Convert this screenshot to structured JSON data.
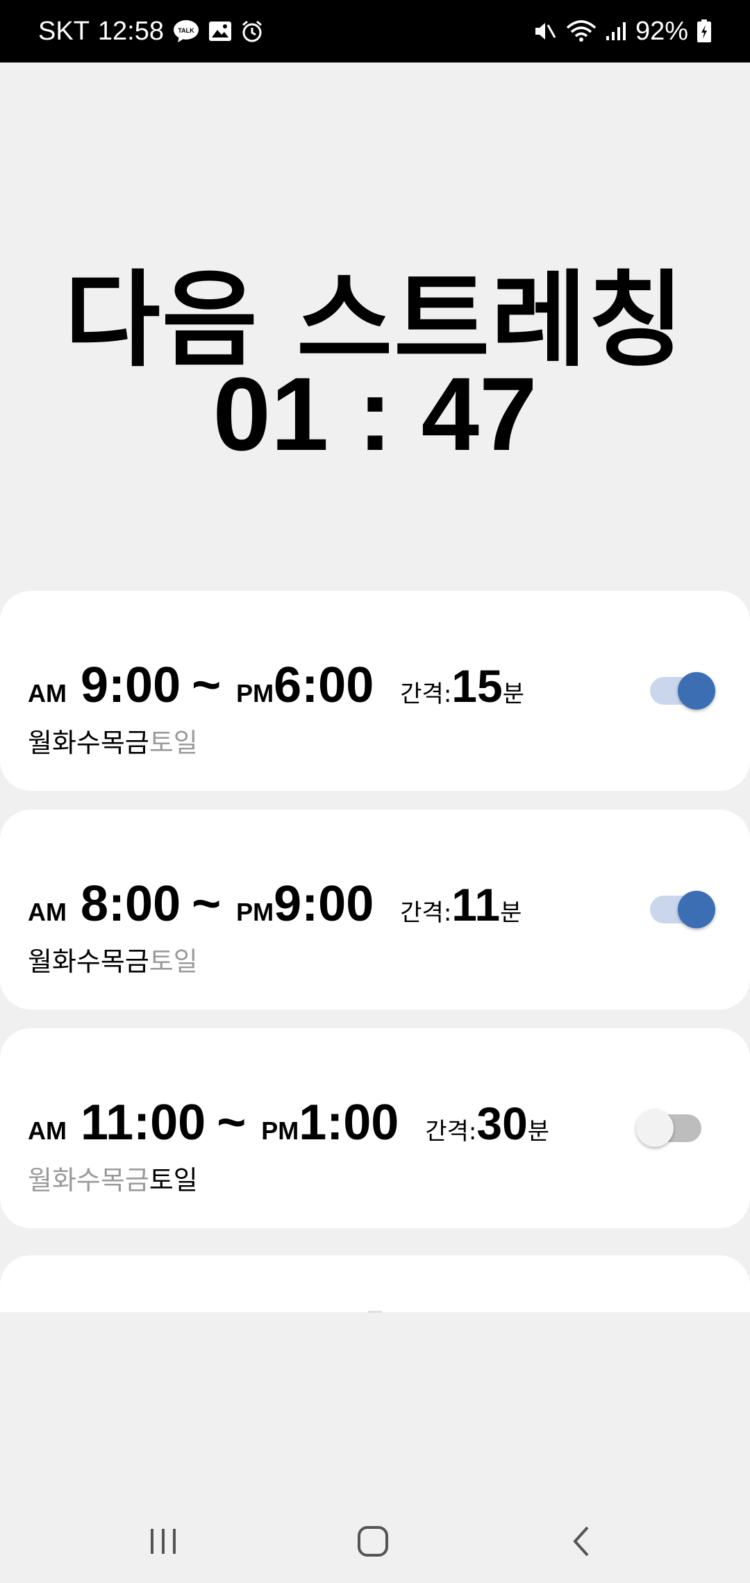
{
  "status_bar": {
    "carrier": "SKT",
    "time": "12:58",
    "talk_icon_text": "TALK",
    "battery": "92%"
  },
  "headline": "다음 스트레칭",
  "countdown": "01 : 47",
  "schedules": [
    {
      "start_ampm": "AM",
      "start_time": "9:00",
      "separator": "~",
      "end_ampm": "PM",
      "end_time": "6:00",
      "interval_label": "간격:",
      "interval_value": "15",
      "interval_unit": "분",
      "days_active": "월화수목금",
      "days_inactive": "토일",
      "enabled": true
    },
    {
      "start_ampm": "AM",
      "start_time": "8:00",
      "separator": "~",
      "end_ampm": "PM",
      "end_time": "9:00",
      "interval_label": "간격:",
      "interval_value": "11",
      "interval_unit": "분",
      "days_active": "월화수목금",
      "days_inactive": "토일",
      "enabled": true
    },
    {
      "start_ampm": "AM",
      "start_time": "11:00",
      "separator": "~",
      "end_ampm": "PM",
      "end_time": "1:00",
      "interval_label": "간격:",
      "interval_value": "30",
      "interval_unit": "분",
      "days_inactive": "월화수목금",
      "days_active": "토일",
      "enabled": false
    }
  ],
  "colors": {
    "accent": "#3c6eb4",
    "inactive_text": "#9a9a9a",
    "background": "#f0f0f0"
  },
  "nav_icons": [
    "recents-icon",
    "home-icon",
    "back-icon"
  ]
}
